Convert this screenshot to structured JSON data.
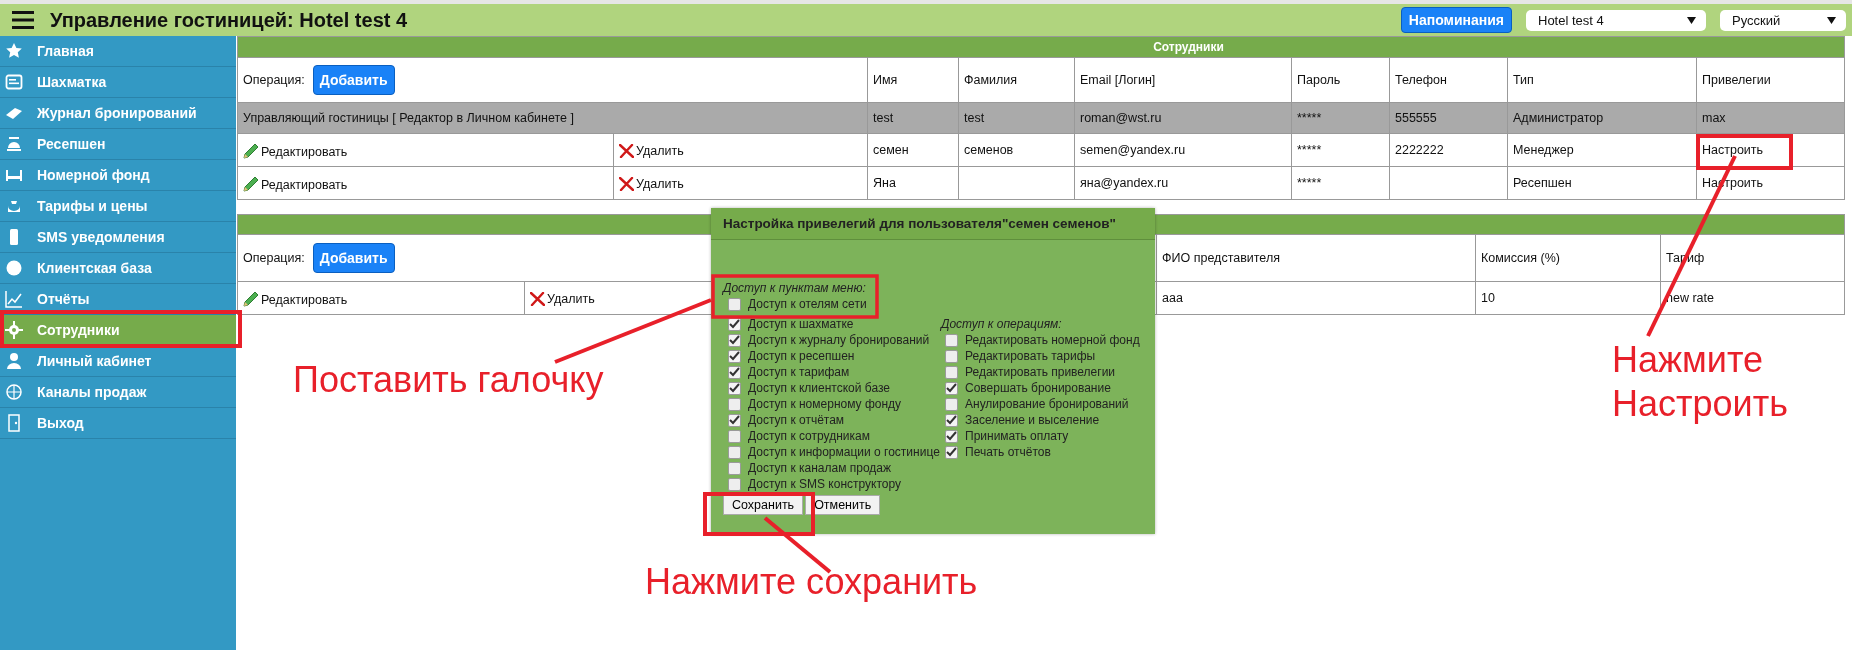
{
  "header": {
    "title": "Управление гостиницей: Hotel test 4",
    "reminders_button": "Напоминания",
    "hotel_select": "Hotel test 4",
    "language_select": "Русский"
  },
  "sidebar": {
    "items": [
      {
        "label": "Главная",
        "selected": false
      },
      {
        "label": "Шахматка",
        "selected": false
      },
      {
        "label": "Журнал бронирований",
        "selected": false
      },
      {
        "label": "Ресепшен",
        "selected": false
      },
      {
        "label": "Номерной фонд",
        "selected": false
      },
      {
        "label": "Тарифы и цены",
        "selected": false
      },
      {
        "label": "SMS уведомления",
        "selected": false
      },
      {
        "label": "Клиентская база",
        "selected": false
      },
      {
        "label": "Отчёты",
        "selected": false
      },
      {
        "label": "Сотрудники",
        "selected": true
      },
      {
        "label": "Личный кабинет",
        "selected": false
      },
      {
        "label": "Каналы продаж",
        "selected": false
      },
      {
        "label": "Выход",
        "selected": false
      }
    ]
  },
  "staff_table": {
    "title": "Сотрудники",
    "operation_label": "Операция:",
    "add_button": "Добавить",
    "columns": [
      "Имя",
      "Фамилия",
      "Email [Логин]",
      "Пароль",
      "Телефон",
      "Тип",
      "Привелегии"
    ],
    "rows": [
      {
        "kind": "owner",
        "label": "Управляющий гостиницы [ Редактор в Личном кабинете ]",
        "cells": [
          "test",
          "test",
          "roman@wst.ru",
          "*****",
          "555555",
          "Администратор",
          "max"
        ]
      },
      {
        "kind": "editable",
        "edit": "Редактировать",
        "delete": "Удалить",
        "cells": [
          "семен",
          "семенов",
          "semen@yandex.ru",
          "*****",
          "2222222",
          "Менеджер",
          "Настроить"
        ]
      },
      {
        "kind": "editable",
        "edit": "Редактировать",
        "delete": "Удалить",
        "cells": [
          "Яна",
          "",
          "яна@yandex.ru",
          "*****",
          "",
          "Ресепшен",
          "Настроить"
        ]
      }
    ]
  },
  "agents_table": {
    "operation_label": "Операция:",
    "add_button": "Добавить",
    "columns": [
      "ФИО представителя",
      "Комиссия (%)",
      "Тариф"
    ],
    "rows": [
      {
        "edit": "Редактировать",
        "delete": "Удалить",
        "cells": [
          "aaa",
          "10",
          "new rate"
        ]
      }
    ]
  },
  "privileges_dialog": {
    "title": "Настройка привелегий для пользователя\"семен семенов\"",
    "menu_access": {
      "title": "Доступ к пунктам меню:",
      "items": [
        {
          "label": "Доступ к отелям сети",
          "checked": false
        },
        {
          "label": "Доступ к шахматке",
          "checked": true
        },
        {
          "label": "Доступ к журналу бронирований",
          "checked": true
        },
        {
          "label": "Доступ к ресепшен",
          "checked": true
        },
        {
          "label": "Доступ к тарифам",
          "checked": true
        },
        {
          "label": "Доступ к клиентской базе",
          "checked": true
        },
        {
          "label": "Доступ к номерному фонду",
          "checked": false
        },
        {
          "label": "Доступ к отчётам",
          "checked": true
        },
        {
          "label": "Доступ к сотрудникам",
          "checked": false
        },
        {
          "label": "Доступ к информации о гостинице",
          "checked": false
        },
        {
          "label": "Доступ к каналам продаж",
          "checked": false
        },
        {
          "label": "Доступ к SMS конструктору",
          "checked": false
        }
      ]
    },
    "operations_access": {
      "title": "Доступ к операциям:",
      "items": [
        {
          "label": "Редактировать номерной фонд",
          "checked": false
        },
        {
          "label": "Редактировать тарифы",
          "checked": false
        },
        {
          "label": "Редактировать привелегии",
          "checked": false
        },
        {
          "label": "Совершать бронирование",
          "checked": true
        },
        {
          "label": "Анулирование бронирований",
          "checked": false
        },
        {
          "label": "Заселение и выселение",
          "checked": true
        },
        {
          "label": "Принимать оплату",
          "checked": true
        },
        {
          "label": "Печать отчётов",
          "checked": true
        }
      ]
    },
    "buttons": [
      "Сохранить",
      "Отменить"
    ]
  },
  "annotations": [
    "Поставить галочку",
    "Нажмите Настроить",
    "Нажмите сохранить"
  ]
}
